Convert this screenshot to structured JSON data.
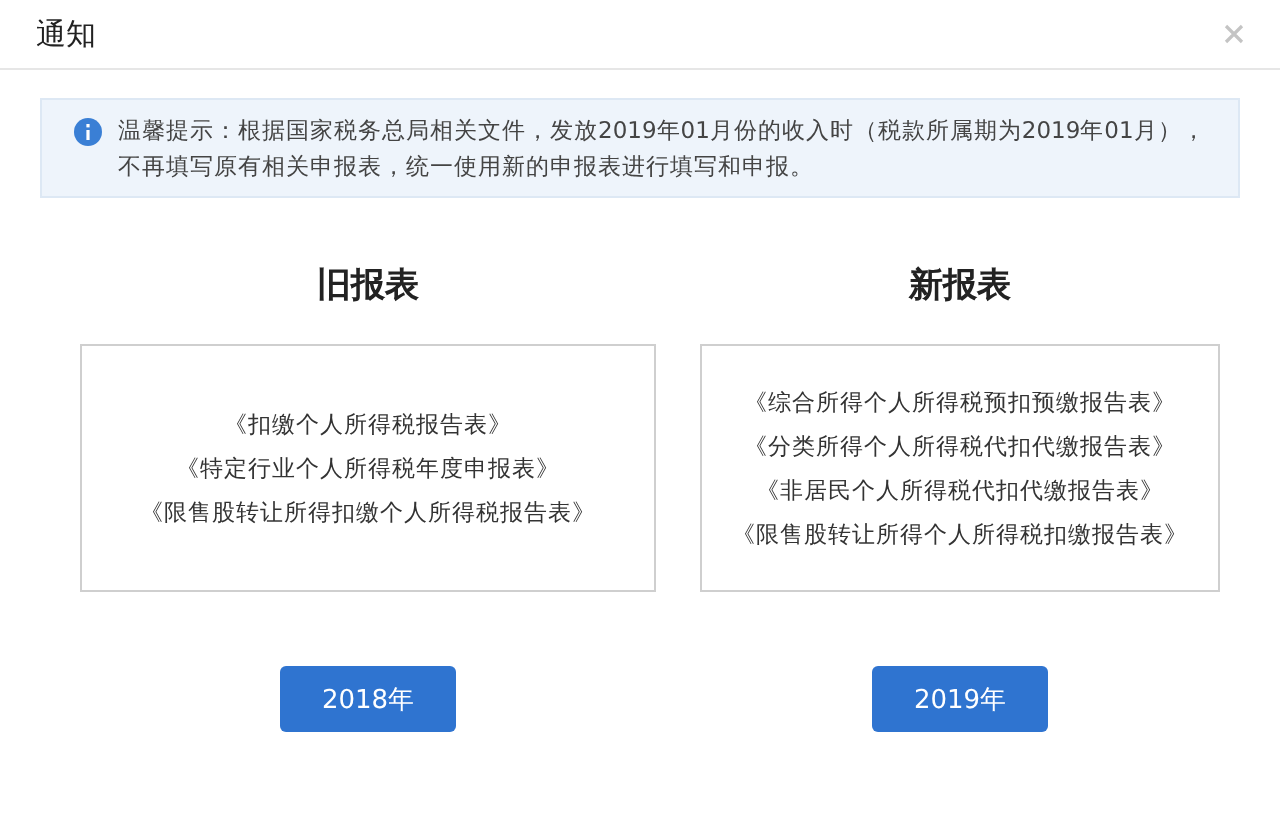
{
  "window": {
    "title": "通知"
  },
  "notice": {
    "text": "温馨提示：根据国家税务总局相关文件，发放2019年01月份的收入时（税款所属期为2019年01月），不再填写原有相关申报表，统一使用新的申报表进行填写和申报。"
  },
  "columns": [
    {
      "heading": "旧报表",
      "forms": [
        "《扣缴个人所得税报告表》",
        "《特定行业个人所得税年度申报表》",
        "《限售股转让所得扣缴个人所得税报告表》"
      ],
      "button": "2018年"
    },
    {
      "heading": "新报表",
      "forms": [
        "《综合所得个人所得税预扣预缴报告表》",
        "《分类所得个人所得税代扣代缴报告表》",
        "《非居民个人所得税代扣代缴报告表》",
        "《限售股转让所得个人所得税扣缴报告表》"
      ],
      "button": "2019年"
    }
  ]
}
